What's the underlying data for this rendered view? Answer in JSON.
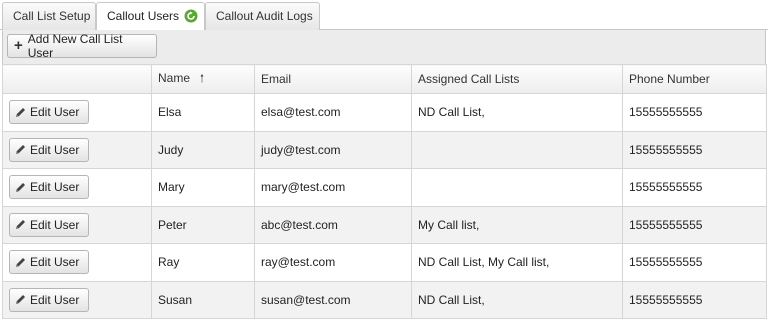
{
  "tabs": [
    {
      "label": "Call List Setup",
      "active": false
    },
    {
      "label": "Callout Users",
      "active": true,
      "icon": "refresh-icon"
    },
    {
      "label": "Callout Audit Logs",
      "active": false
    }
  ],
  "toolbar": {
    "add_label": "Add New Call List User",
    "add_icon": "plus-icon"
  },
  "table": {
    "columns": [
      "",
      "Name",
      "Email",
      "Assigned Call Lists",
      "Phone Number"
    ],
    "sort_column": "Name",
    "sort_direction": "ascending",
    "edit_label": "Edit User",
    "rows": [
      {
        "name": "Elsa",
        "email": "elsa@test.com",
        "lists": "ND Call List,",
        "phone": "15555555555"
      },
      {
        "name": "Judy",
        "email": "judy@test.com",
        "lists": "",
        "phone": "15555555555"
      },
      {
        "name": "Mary",
        "email": "mary@test.com",
        "lists": "",
        "phone": "15555555555"
      },
      {
        "name": "Peter",
        "email": "abc@test.com",
        "lists": "My Call list,",
        "phone": "15555555555"
      },
      {
        "name": "Ray",
        "email": "ray@test.com",
        "lists": "ND Call List, My Call list,",
        "phone": "15555555555"
      },
      {
        "name": "Susan",
        "email": "susan@test.com",
        "lists": "ND Call List,",
        "phone": "15555555555"
      }
    ]
  },
  "colors": {
    "accent_icon": "#5aa832",
    "alt_row": "#f2f2f2",
    "toolbar": "#ececec"
  }
}
